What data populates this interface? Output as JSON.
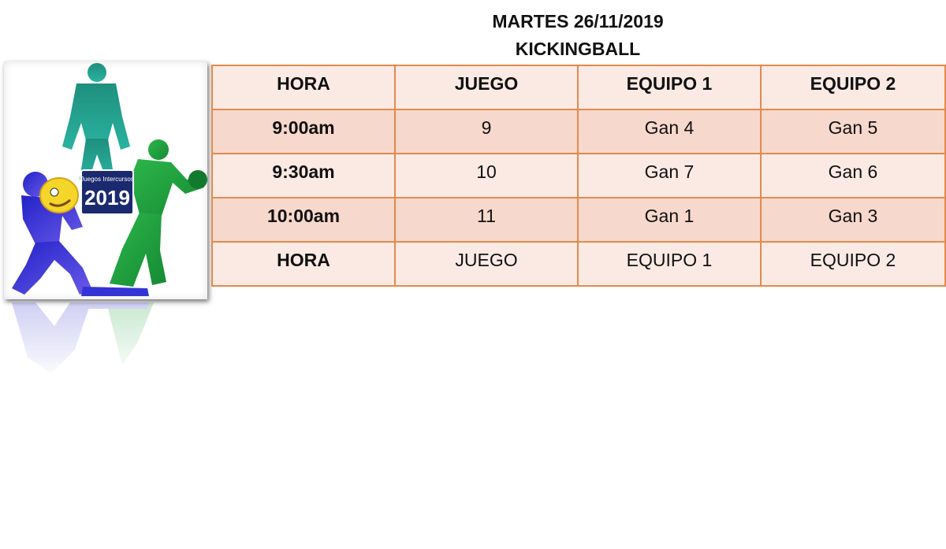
{
  "title": {
    "date_line": "MARTES 26/11/2019",
    "sport_line": "KICKINGBALL"
  },
  "logo": {
    "badge_text": "Juegos Intercursos",
    "badge_year": "2019"
  },
  "colors": {
    "border": "#e38a4e",
    "row_light": "#fbeae4",
    "row_dark": "#f7d8cc",
    "figure_teal": "#1f9a86",
    "figure_green": "#22a23c",
    "figure_blue": "#3a3ad0",
    "figure_yellow": "#f2d230"
  },
  "table": {
    "header": [
      "HORA",
      "JUEGO",
      "EQUIPO 1",
      "EQUIPO 2"
    ],
    "rows": [
      [
        "9:00am",
        "9",
        "Gan 4",
        "Gan 5"
      ],
      [
        "9:30am",
        "10",
        "Gan 7",
        "Gan 6"
      ],
      [
        "10:00am",
        "11",
        "Gan 1",
        "Gan 3"
      ]
    ],
    "footer": [
      "HORA",
      "JUEGO",
      "EQUIPO 1",
      "EQUIPO 2"
    ]
  }
}
